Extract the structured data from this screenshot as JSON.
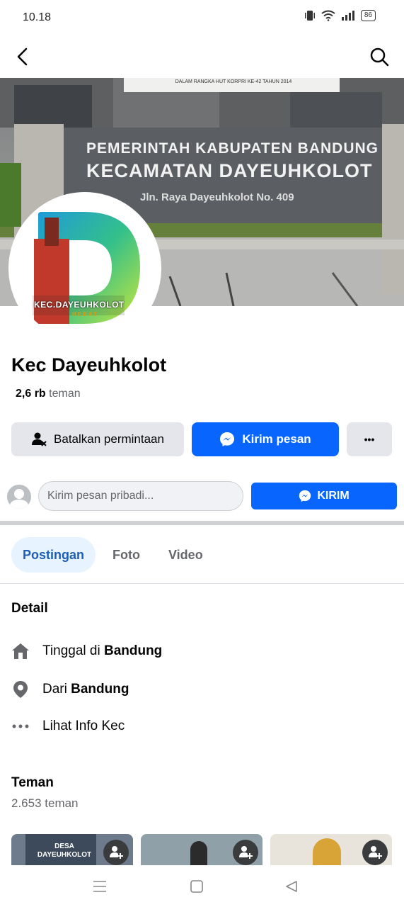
{
  "status": {
    "time": "10.18",
    "battery": "86"
  },
  "cover": {
    "banner_line1": "PEMERINTAH KABUPATEN BANDUNG",
    "banner_line2": "KECAMATAN DAYEUHKOLOT",
    "banner_line3": "Jln. Raya Dayeuhkolot No. 409",
    "top_sign": "DALAM RANGKA HUT KORPRI KE-42 TAHUN 2014"
  },
  "profile_logo": {
    "line1": "KEC.DAYEUHKOLOT",
    "line2": "HEBAT"
  },
  "profile": {
    "name": "Kec Dayeuhkolot",
    "friends_bold": "2,6 rb",
    "friends_suffix": "teman"
  },
  "actions": {
    "cancel_label": "Batalkan permintaan",
    "message_label": "Kirim pesan",
    "more_label": "•••"
  },
  "private_message": {
    "placeholder": "Kirim pesan pribadi...",
    "send_label": "KIRIM"
  },
  "tabs": [
    {
      "label": "Postingan"
    },
    {
      "label": "Foto"
    },
    {
      "label": "Video"
    }
  ],
  "detail": {
    "title": "Detail",
    "lives_prefix": "Tinggal di",
    "lives_value": "Bandung",
    "from_prefix": "Dari",
    "from_value": "Bandung",
    "info_label": "Lihat Info Kec"
  },
  "friends": {
    "title": "Teman",
    "count_text": "2.653 teman",
    "cards": [
      {
        "caption": "DESA DAYEUHKOLOT"
      },
      {
        "caption": ""
      },
      {
        "caption": ""
      }
    ]
  },
  "colors": {
    "primary": "#0866ff",
    "tab_active_bg": "#e7f3ff",
    "tab_active_text": "#1d5fb8",
    "button_grey": "#e4e6eb"
  }
}
